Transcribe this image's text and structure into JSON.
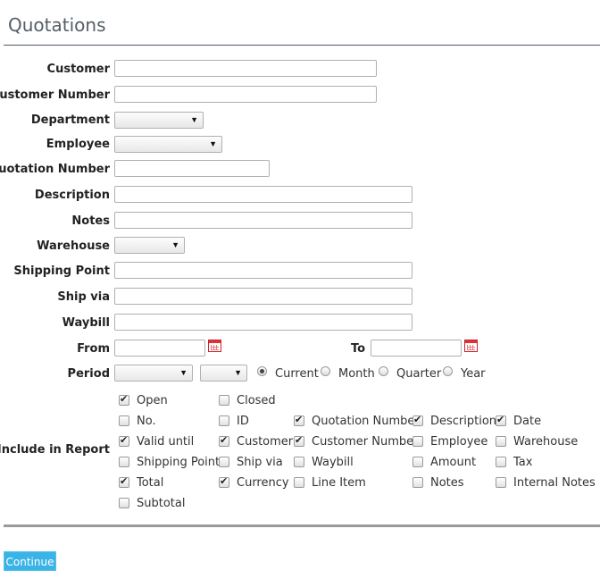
{
  "page": {
    "title": "Quotations"
  },
  "fields": {
    "customer": {
      "label": "Customer",
      "value": ""
    },
    "customer_number": {
      "label": "Customer Number",
      "value": ""
    },
    "department": {
      "label": "Department",
      "value": ""
    },
    "employee": {
      "label": "Employee",
      "value": ""
    },
    "quotation_number": {
      "label": "Quotation Number",
      "value": ""
    },
    "description": {
      "label": "Description",
      "value": ""
    },
    "notes": {
      "label": "Notes",
      "value": ""
    },
    "warehouse": {
      "label": "Warehouse",
      "value": ""
    },
    "shipping_point": {
      "label": "Shipping Point",
      "value": ""
    },
    "ship_via": {
      "label": "Ship via",
      "value": ""
    },
    "waybill": {
      "label": "Waybill",
      "value": ""
    },
    "from": {
      "label": "From",
      "value": ""
    },
    "to": {
      "label": "To",
      "value": ""
    },
    "period": {
      "label": "Period",
      "options": [
        "Current",
        "Month",
        "Quarter",
        "Year"
      ],
      "selected": "Current"
    }
  },
  "include_in_report": {
    "label": "Include in Report",
    "items": [
      {
        "label": "Open",
        "checked": true
      },
      {
        "label": "Closed",
        "checked": false
      },
      {
        "label": "No.",
        "checked": false
      },
      {
        "label": "ID",
        "checked": false
      },
      {
        "label": "Quotation Number",
        "checked": true
      },
      {
        "label": "Description",
        "checked": true
      },
      {
        "label": "Date",
        "checked": true
      },
      {
        "label": "Valid until",
        "checked": true
      },
      {
        "label": "Customer",
        "checked": true
      },
      {
        "label": "Customer Number",
        "checked": true
      },
      {
        "label": "Employee",
        "checked": false
      },
      {
        "label": "Warehouse",
        "checked": false
      },
      {
        "label": "Shipping Point",
        "checked": false
      },
      {
        "label": "Ship via",
        "checked": false
      },
      {
        "label": "Waybill",
        "checked": false
      },
      {
        "label": "Amount",
        "checked": false
      },
      {
        "label": "Tax",
        "checked": false
      },
      {
        "label": "Total",
        "checked": true
      },
      {
        "label": "Currency",
        "checked": true
      },
      {
        "label": "Line Item",
        "checked": false
      },
      {
        "label": "Notes",
        "checked": false
      },
      {
        "label": "Internal Notes",
        "checked": false
      },
      {
        "label": "Subtotal",
        "checked": false
      }
    ]
  },
  "actions": {
    "continue_label": "Continue"
  },
  "icons": {
    "calendar": "calendar-icon",
    "dropdown": "chevron-down-icon"
  }
}
